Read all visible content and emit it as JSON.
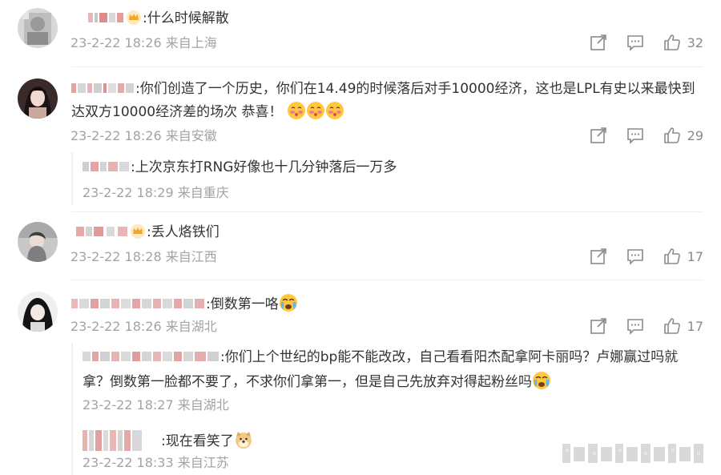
{
  "comments": [
    {
      "text": ":什么时候解散",
      "time": "23-2-22 18:26 来自上海",
      "likes": "32"
    },
    {
      "text_line1": ":你们创造了一个历史，你们在14.49的时候落后对手10000经济，这也是LPL有史以来最快到",
      "text_line2": "达双方10000经济差的场次 恭喜！",
      "time": "23-2-22 18:26 来自安徽",
      "likes": "29",
      "replies": [
        {
          "text": ":上次京东打RNG好像也十几分钟落后一万多",
          "time": "23-2-22 18:29 来自重庆"
        }
      ]
    },
    {
      "text": ":丢人烙铁们",
      "time": "23-2-22 18:28 来自江西",
      "likes": "17"
    },
    {
      "text": ":倒数第一咯",
      "time": "23-2-22 18:26 来自湖北",
      "likes": "17",
      "replies": [
        {
          "text_line1": ":你们上个世纪的bp能不能改改，自己看看阳杰配拿阿卡丽吗？卢娜赢过吗就",
          "text_line2": "拿？倒数第一脸都不要了，不求你们拿第一，但是自己先放弃对得起粉丝吗",
          "time": "23-2-22 18:27 来自湖北"
        },
        {
          "text": ":现在看笑了",
          "time": "23-2-22 18:33 来自江苏"
        }
      ]
    }
  ],
  "icons": {
    "share": "share-icon",
    "comment": "comment-icon",
    "like": "thumbs-up-icon",
    "crown": "crown-badge-icon",
    "emoji_blush": "blushing-face-emoji",
    "emoji_cry": "crying-face-emoji",
    "emoji_dog": "doge-emoji"
  },
  "colors": {
    "text": "#333333",
    "meta": "#a3a3a3",
    "icon": "#8a8a8a",
    "crown": "#f5a623"
  }
}
